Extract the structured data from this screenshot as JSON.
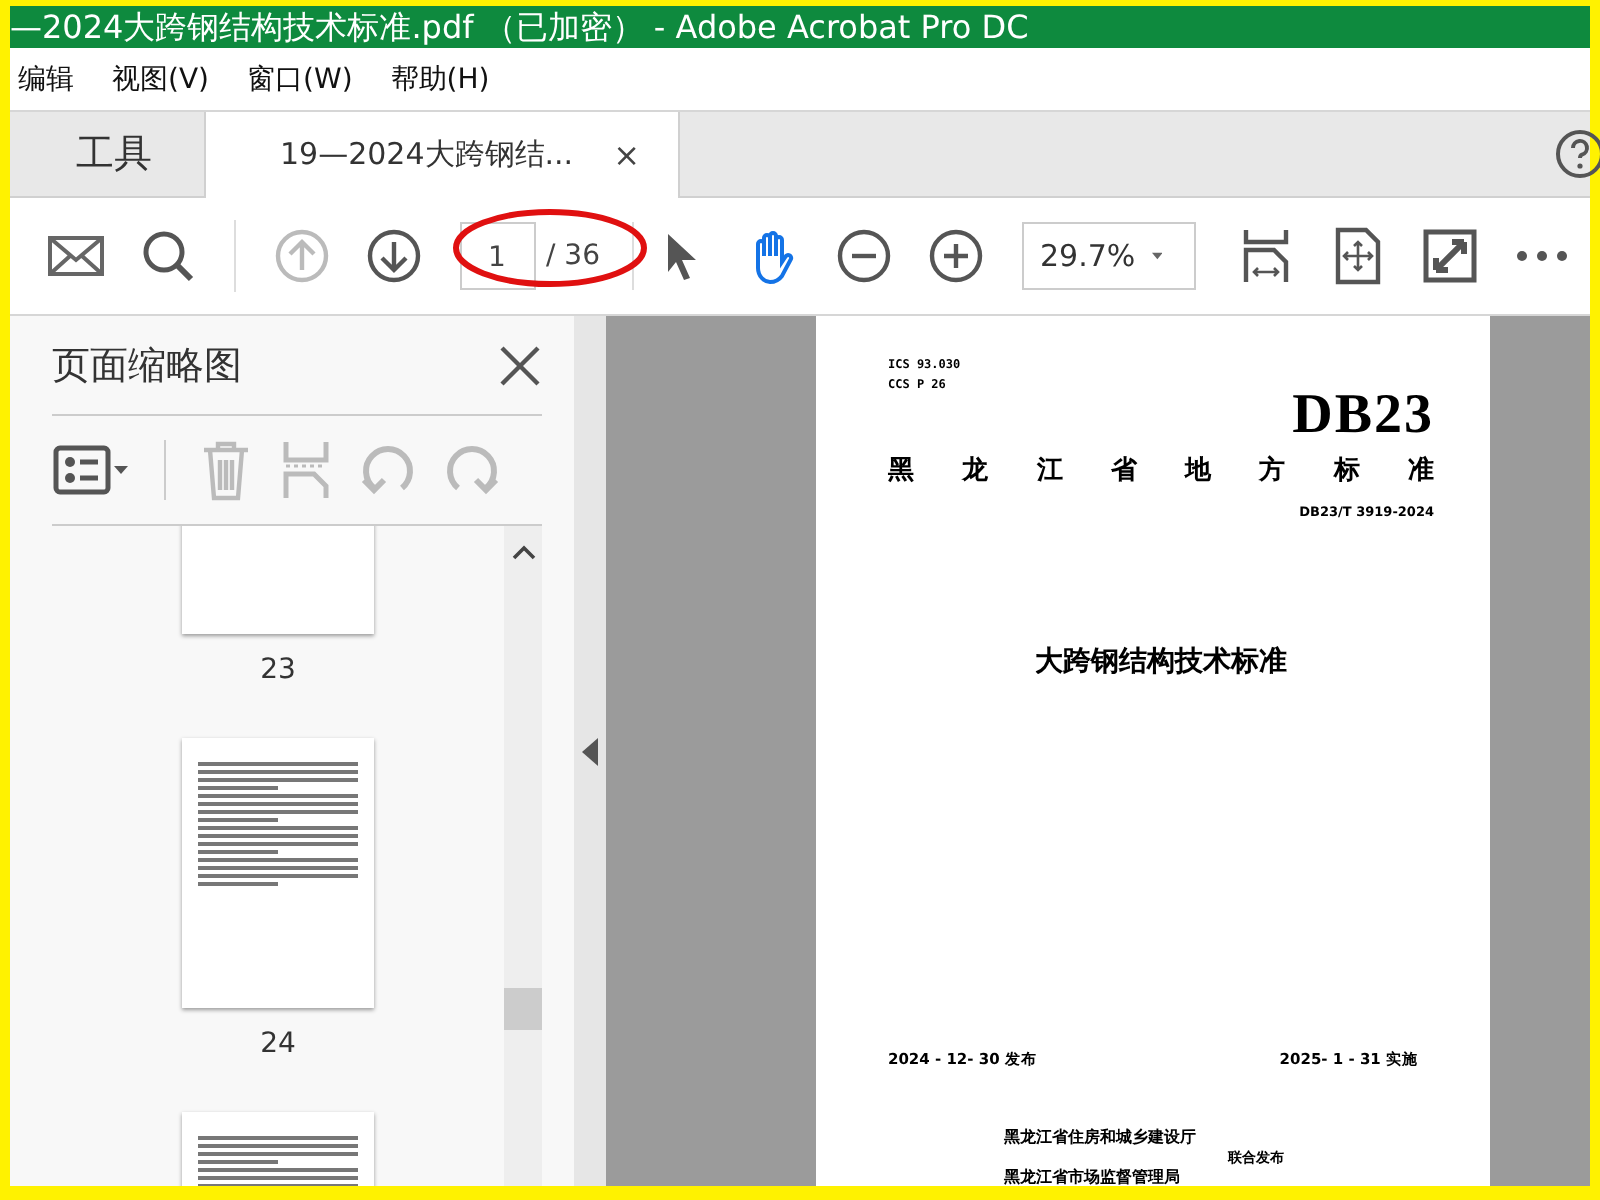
{
  "window": {
    "title": "—2024大跨钢结构技术标准.pdf （已加密） - Adobe Acrobat Pro DC"
  },
  "menu": [
    "编辑",
    "视图(V)",
    "窗口(W)",
    "帮助(H)"
  ],
  "tabs": [
    {
      "label": "工具",
      "selected": false
    },
    {
      "label": "19—2024大跨钢结...",
      "selected": true,
      "close": "×"
    }
  ],
  "toolbar": {
    "prev_page": {
      "disabled": true
    },
    "next_page": {
      "disabled": false
    },
    "page_number": "1",
    "page_total": "/ 36",
    "select_tool": {
      "selected": false
    },
    "hand_tool": {
      "selected": true
    },
    "zoom": "29.7%"
  },
  "thumbnail_panel": {
    "title": "页面缩略图",
    "tools_disabled": true,
    "pages": [
      {
        "label": "23"
      },
      {
        "label": "24"
      }
    ]
  },
  "document": {
    "ics": "ICS 93.030",
    "ccs": "CCS P 26",
    "code": "DB23",
    "category": "黑 龙 江 省 地 方 标 准",
    "number": "DB23/T 3919-2024",
    "title": "大跨钢结构技术标准",
    "issued": "2024 - 12- 30 发布",
    "effective": "2025- 1 - 31 实施",
    "issuers": [
      "黑龙江省住房和城乡建设厅",
      "黑龙江省市场监督管理局"
    ],
    "joint": "联合发布"
  }
}
